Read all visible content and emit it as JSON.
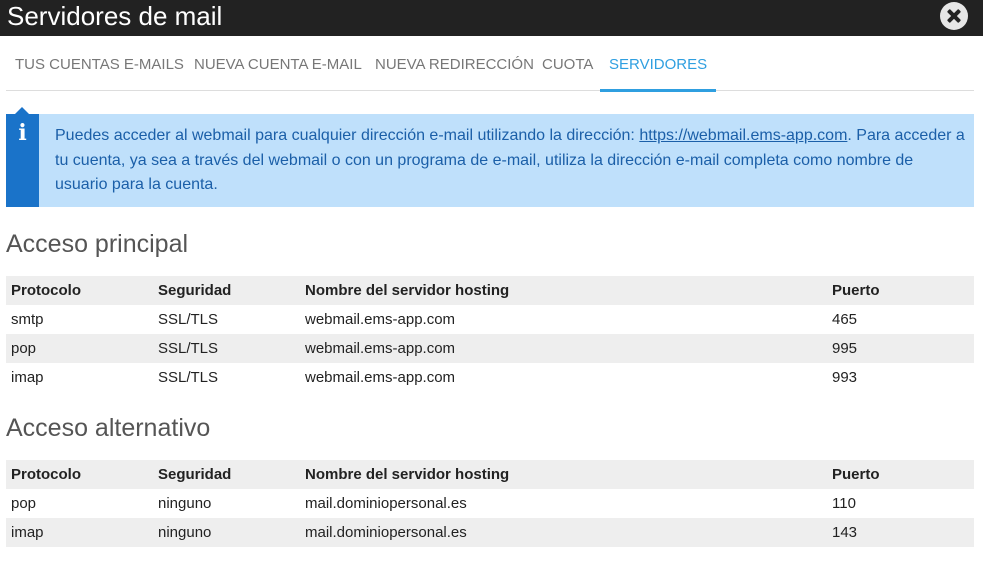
{
  "window": {
    "title": "Servidores de mail"
  },
  "tabs": [
    {
      "label": "TUS CUENTAS E-MAILS"
    },
    {
      "label": "NUEVA CUENTA E-MAIL"
    },
    {
      "label": "NUEVA REDIRECCIÓN"
    },
    {
      "label": "CUOTA"
    },
    {
      "label": "SERVIDORES",
      "active": true
    }
  ],
  "notice": {
    "icon": "info-icon",
    "text_before": "Puedes acceder al webmail para cualquier dirección e-mail utilizando la dirección: ",
    "link": "https://webmail.ems-app.com",
    "text_after": ". Para acceder a tu cuenta, ya sea a través del webmail o con un programa de e-mail, utiliza la dirección e-mail completa como nombre de usuario para la cuenta."
  },
  "columns": {
    "protocol": "Protocolo",
    "security": "Seguridad",
    "host": "Nombre del servidor hosting",
    "port": "Puerto"
  },
  "primary": {
    "title": "Acceso principal",
    "rows": [
      {
        "protocol": "smtp",
        "security": "SSL/TLS",
        "host": "webmail.ems-app.com",
        "port": "465"
      },
      {
        "protocol": "pop",
        "security": "SSL/TLS",
        "host": "webmail.ems-app.com",
        "port": "995"
      },
      {
        "protocol": "imap",
        "security": "SSL/TLS",
        "host": "webmail.ems-app.com",
        "port": "993"
      }
    ]
  },
  "alternative": {
    "title": "Acceso alternativo",
    "rows": [
      {
        "protocol": "pop",
        "security": "ninguno",
        "host": "mail.dominiopersonal.es",
        "port": "110"
      },
      {
        "protocol": "imap",
        "security": "ninguno",
        "host": "mail.dominiopersonal.es",
        "port": "143"
      }
    ]
  },
  "colors": {
    "titlebar": "#222222",
    "accent": "#2f9fe0",
    "notice_bg": "#bfe0fb",
    "notice_stripe": "#1a73c9",
    "notice_text": "#1b5fa8",
    "row_shade": "#eeeeee"
  }
}
